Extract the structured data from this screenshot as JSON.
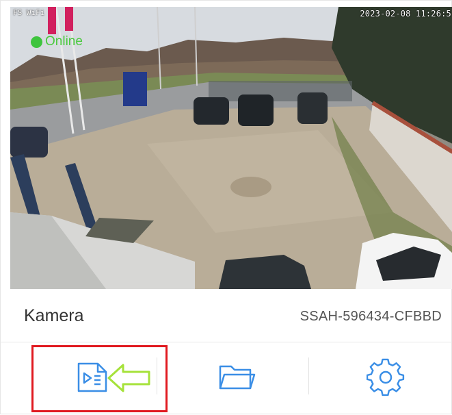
{
  "feed": {
    "osd_label": "FS WiFi",
    "timestamp": "2023-02-08 11:26:5",
    "status_text": "Online",
    "status_color": "#3ec43e"
  },
  "camera": {
    "name": "Kamera",
    "id": "SSAH-596434-CFBBD"
  },
  "actions": [
    {
      "name": "playback",
      "icon": "playback-file-icon"
    },
    {
      "name": "files",
      "icon": "folder-icon"
    },
    {
      "name": "settings",
      "icon": "gear-icon"
    }
  ],
  "colors": {
    "accent": "#3a8ee6",
    "highlight": "#e0191f",
    "arrow": "#a6e23a"
  }
}
